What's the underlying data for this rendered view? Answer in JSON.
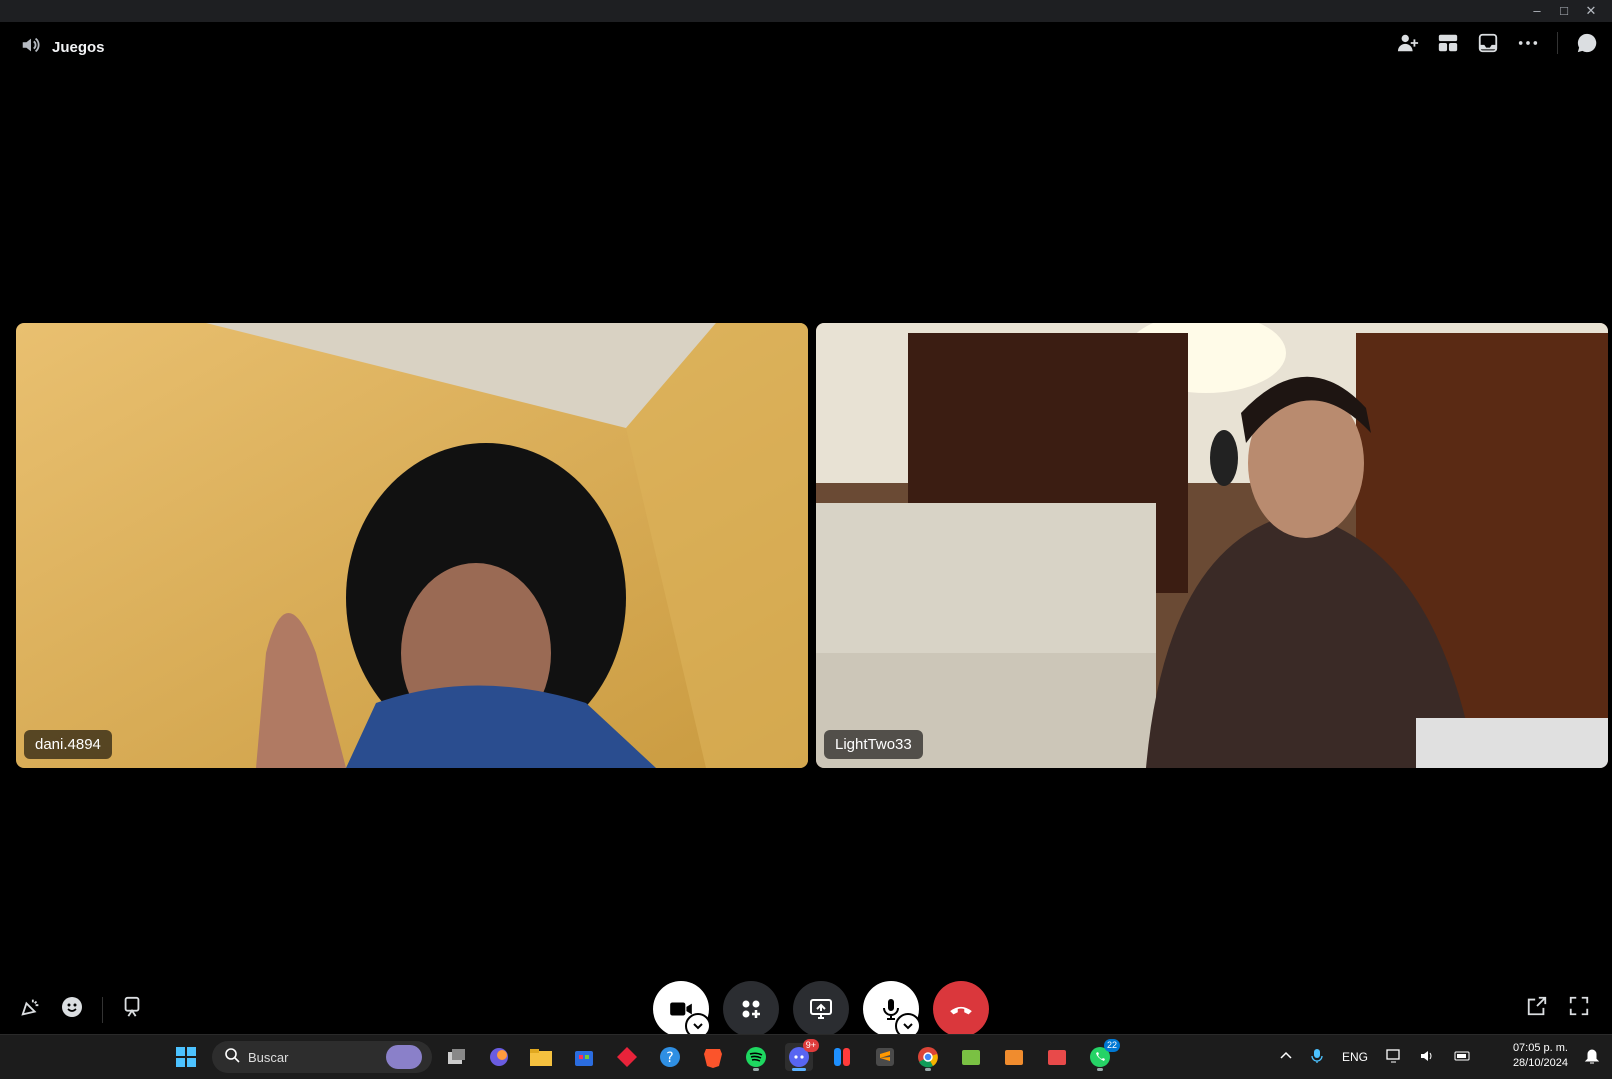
{
  "header": {
    "channel": "Juegos"
  },
  "participants": [
    {
      "name": "dani.4894"
    },
    {
      "name": "LightTwo33"
    }
  ],
  "colors": {
    "end_call": "#da373c",
    "accent": "#5865f2"
  },
  "taskbar": {
    "search_placeholder": "Buscar",
    "discord_badge": "9+",
    "whatsapp_badge": "22",
    "language": "ENG",
    "time": "07:05 p. m.",
    "date": "28/10/2024"
  }
}
